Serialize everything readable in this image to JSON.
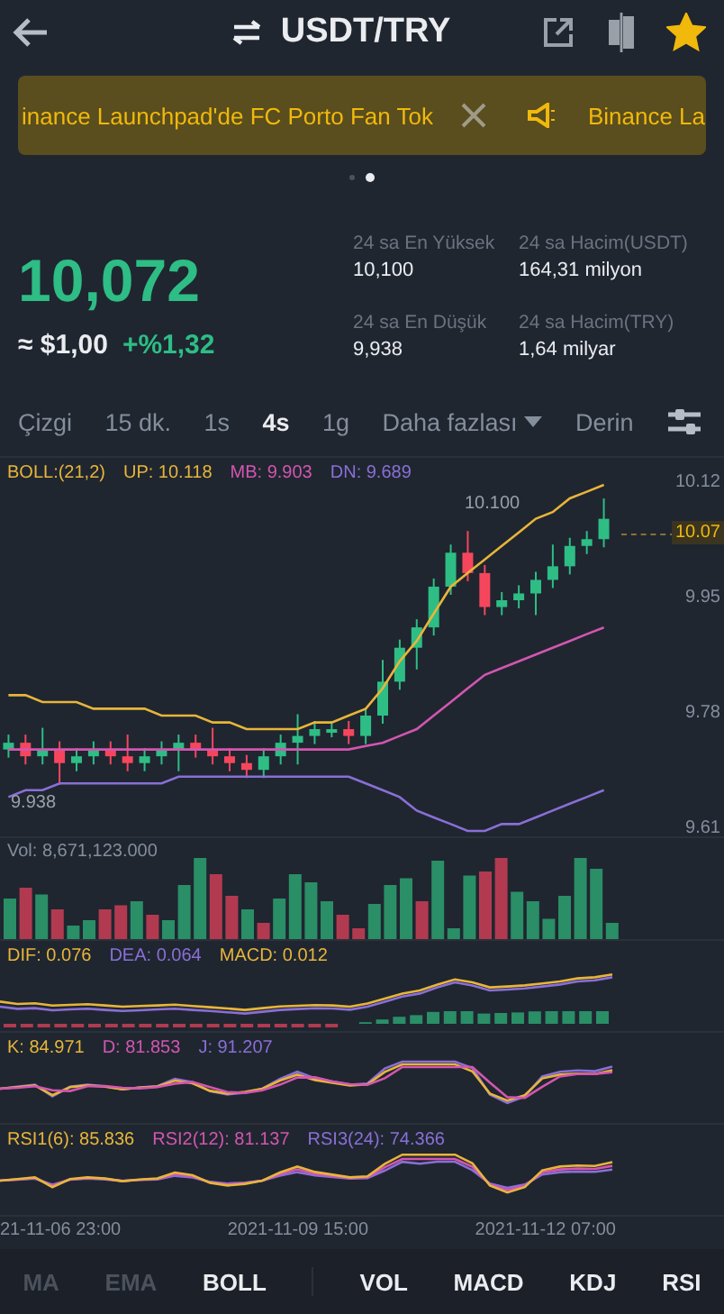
{
  "header": {
    "title": "USDT/TRY",
    "favorite": true
  },
  "banner": {
    "texts": [
      "inance Launchpad'de FC Porto Fan Tok",
      "Binance La"
    ]
  },
  "pager": [
    {
      "selected": false
    },
    {
      "selected": true
    }
  ],
  "price": {
    "last": "10,072",
    "usd": "≈ $1,00",
    "change": "+%1,32"
  },
  "stats": [
    {
      "label": "24 sa En Yüksek",
      "value": "10,100"
    },
    {
      "label": "24 sa Hacim(USDT)",
      "value": "164,31 milyon"
    },
    {
      "label": "24 sa En Düşük",
      "value": "9,938"
    },
    {
      "label": "24 sa Hacim(TRY)",
      "value": "1,64 milyar"
    }
  ],
  "intervals": [
    {
      "label": "Çizgi",
      "selected": false,
      "kind": "tab"
    },
    {
      "label": "15 dk.",
      "selected": false,
      "kind": "tab"
    },
    {
      "label": "1s",
      "selected": false,
      "kind": "tab"
    },
    {
      "label": "4s",
      "selected": true,
      "kind": "tab"
    },
    {
      "label": "1g",
      "selected": false,
      "kind": "tab"
    },
    {
      "label": "Daha fazlası",
      "selected": false,
      "kind": "dropdown"
    },
    {
      "label": "Derin",
      "selected": false,
      "kind": "tab"
    }
  ],
  "main_chart": {
    "legend_title": "BOLL:(21,2)",
    "chart_data": {
      "type": "candlestick",
      "ylim": [
        9.61,
        10.12
      ],
      "categories": [
        null,
        null,
        null,
        null,
        null,
        null,
        null,
        null,
        null,
        null,
        null,
        null,
        null,
        null,
        null,
        null,
        null,
        null,
        null,
        null,
        null,
        null,
        null,
        null,
        null,
        null,
        null,
        null,
        null,
        null,
        null,
        null,
        null,
        null,
        null,
        null
      ],
      "ohlc": [
        [
          9.73,
          9.752,
          9.718,
          9.74
        ],
        [
          9.74,
          9.752,
          9.708,
          9.72
        ],
        [
          9.72,
          9.762,
          9.708,
          9.73
        ],
        [
          9.73,
          9.742,
          9.678,
          9.71
        ],
        [
          9.71,
          9.732,
          9.698,
          9.72
        ],
        [
          9.72,
          9.742,
          9.708,
          9.73
        ],
        [
          9.73,
          9.742,
          9.708,
          9.72
        ],
        [
          9.72,
          9.752,
          9.698,
          9.71
        ],
        [
          9.71,
          9.732,
          9.698,
          9.72
        ],
        [
          9.72,
          9.742,
          9.708,
          9.73
        ],
        [
          9.73,
          9.752,
          9.698,
          9.74
        ],
        [
          9.74,
          9.752,
          9.718,
          9.73
        ],
        [
          9.73,
          9.762,
          9.708,
          9.72
        ],
        [
          9.72,
          9.732,
          9.698,
          9.71
        ],
        [
          9.71,
          9.722,
          9.688,
          9.7
        ],
        [
          9.7,
          9.732,
          9.688,
          9.72
        ],
        [
          9.72,
          9.752,
          9.708,
          9.74
        ],
        [
          9.74,
          9.782,
          9.708,
          9.75
        ],
        [
          9.75,
          9.772,
          9.738,
          9.76
        ],
        [
          9.76,
          9.772,
          9.748,
          9.76
        ],
        [
          9.76,
          9.772,
          9.738,
          9.75
        ],
        [
          9.75,
          9.792,
          9.738,
          9.78
        ],
        [
          9.78,
          9.862,
          9.768,
          9.83
        ],
        [
          9.83,
          9.892,
          9.818,
          9.88
        ],
        [
          9.88,
          9.922,
          9.848,
          9.91
        ],
        [
          9.91,
          9.982,
          9.898,
          9.97
        ],
        [
          9.97,
          10.032,
          9.958,
          10.02
        ],
        [
          10.02,
          10.052,
          9.978,
          9.99
        ],
        [
          9.99,
          10.002,
          9.928,
          9.94
        ],
        [
          9.94,
          9.962,
          9.928,
          9.95
        ],
        [
          9.95,
          9.972,
          9.938,
          9.96
        ],
        [
          9.96,
          9.992,
          9.928,
          9.98
        ],
        [
          9.98,
          10.032,
          9.968,
          10.0
        ],
        [
          10.0,
          10.042,
          9.988,
          10.03
        ],
        [
          10.03,
          10.052,
          10.018,
          10.04
        ],
        [
          10.04,
          10.1,
          10.028,
          10.07
        ]
      ],
      "yticks": [
        {
          "value": 10.12,
          "label": "10.12"
        },
        {
          "value": 9.95,
          "label": "9.95"
        },
        {
          "value": 9.78,
          "label": "9.78"
        },
        {
          "value": 9.61,
          "label": "9.61"
        }
      ],
      "series": [
        {
          "name": "UP: 10.118",
          "type": "line",
          "color": "#e8b53a",
          "values": [
            9.81,
            9.81,
            9.8,
            9.8,
            9.8,
            9.79,
            9.79,
            9.79,
            9.79,
            9.78,
            9.78,
            9.78,
            9.77,
            9.77,
            9.76,
            9.76,
            9.76,
            9.76,
            9.77,
            9.77,
            9.78,
            9.79,
            9.82,
            9.86,
            9.89,
            9.93,
            9.97,
            9.99,
            10.01,
            10.03,
            10.05,
            10.07,
            10.08,
            10.1,
            10.11,
            10.12
          ]
        },
        {
          "name": "MB: 9.903",
          "type": "line",
          "color": "#d356b0",
          "values": [
            9.73,
            9.73,
            9.73,
            9.73,
            9.73,
            9.73,
            9.73,
            9.73,
            9.73,
            9.73,
            9.73,
            9.73,
            9.73,
            9.73,
            9.73,
            9.73,
            9.73,
            9.73,
            9.73,
            9.73,
            9.73,
            9.735,
            9.74,
            9.75,
            9.76,
            9.78,
            9.8,
            9.82,
            9.84,
            9.85,
            9.86,
            9.87,
            9.88,
            9.89,
            9.9,
            9.91
          ]
        },
        {
          "name": "DN: 9.689",
          "type": "line",
          "color": "#8a6fd6",
          "values": [
            9.66,
            9.67,
            9.67,
            9.68,
            9.68,
            9.68,
            9.68,
            9.68,
            9.68,
            9.68,
            9.69,
            9.69,
            9.69,
            9.69,
            9.69,
            9.69,
            9.69,
            9.69,
            9.69,
            9.69,
            9.69,
            9.68,
            9.67,
            9.66,
            9.64,
            9.63,
            9.62,
            9.61,
            9.61,
            9.62,
            9.62,
            9.63,
            9.64,
            9.65,
            9.66,
            9.67
          ]
        }
      ]
    },
    "high_marker": "10.100",
    "current_price": "10.07",
    "low_marker": "9.938"
  },
  "volume": {
    "legend": "Vol: 8,671,123.000"
  },
  "macd": {
    "legend": [
      {
        "text": "DIF: 0.076",
        "color": "#e8b53a"
      },
      {
        "text": "DEA: 0.064",
        "color": "#8a6fd6"
      },
      {
        "text": "MACD: 0.012",
        "color": "#e8b53a"
      }
    ]
  },
  "kdj": {
    "legend": [
      {
        "text": "K: 84.971",
        "color": "#e8b53a"
      },
      {
        "text": "D: 81.853",
        "color": "#d356b0"
      },
      {
        "text": "J: 91.207",
        "color": "#8a6fd6"
      }
    ]
  },
  "rsi": {
    "legend": [
      {
        "text": "RSI1(6): 85.836",
        "color": "#e8b53a"
      },
      {
        "text": "RSI2(12): 81.137",
        "color": "#d356b0"
      },
      {
        "text": "RSI3(24): 74.366",
        "color": "#8a6fd6"
      }
    ]
  },
  "time_labels": [
    "21-11-06 23:00",
    "2021-11-09 15:00",
    "2021-11-12 07:00"
  ],
  "main_indicators": [
    {
      "label": "MA",
      "selected": false
    },
    {
      "label": "EMA",
      "selected": false
    },
    {
      "label": "BOLL",
      "selected": true
    }
  ],
  "sub_indicators": [
    {
      "label": "VOL",
      "selected": true
    },
    {
      "label": "MACD",
      "selected": true
    },
    {
      "label": "KDJ",
      "selected": true
    },
    {
      "label": "RSI",
      "selected": true
    }
  ]
}
